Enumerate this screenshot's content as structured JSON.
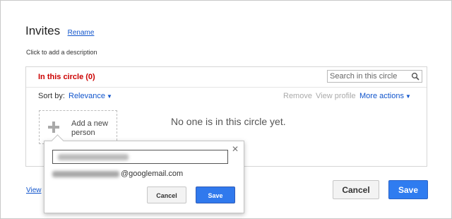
{
  "dialog": {
    "title": "Invites",
    "rename_link": "Rename",
    "description_hint": "Click to add a description",
    "view_link": "View"
  },
  "panel": {
    "heading": "In this circle (0)",
    "search_placeholder": "Search in this circle",
    "sort_label": "Sort by:",
    "sort_value": "Relevance",
    "remove_label": "Remove",
    "view_profile_label": "View profile",
    "more_actions_label": "More actions",
    "add_person_label": "Add a new person",
    "empty_message": "No one is in this circle yet."
  },
  "popup": {
    "close_glyph": "✕",
    "email_domain": "@googlemail.com",
    "cancel_label": "Cancel",
    "save_label": "Save"
  },
  "footer": {
    "cancel_label": "Cancel",
    "save_label": "Save"
  },
  "icons": {
    "search": "search-icon",
    "plus": "plus-icon",
    "dropdown": "chevron-down-icon",
    "close": "close-icon"
  },
  "colors": {
    "heading_red": "#cc0000",
    "link_blue": "#1155cc",
    "primary_blue": "#2f7cf0"
  }
}
